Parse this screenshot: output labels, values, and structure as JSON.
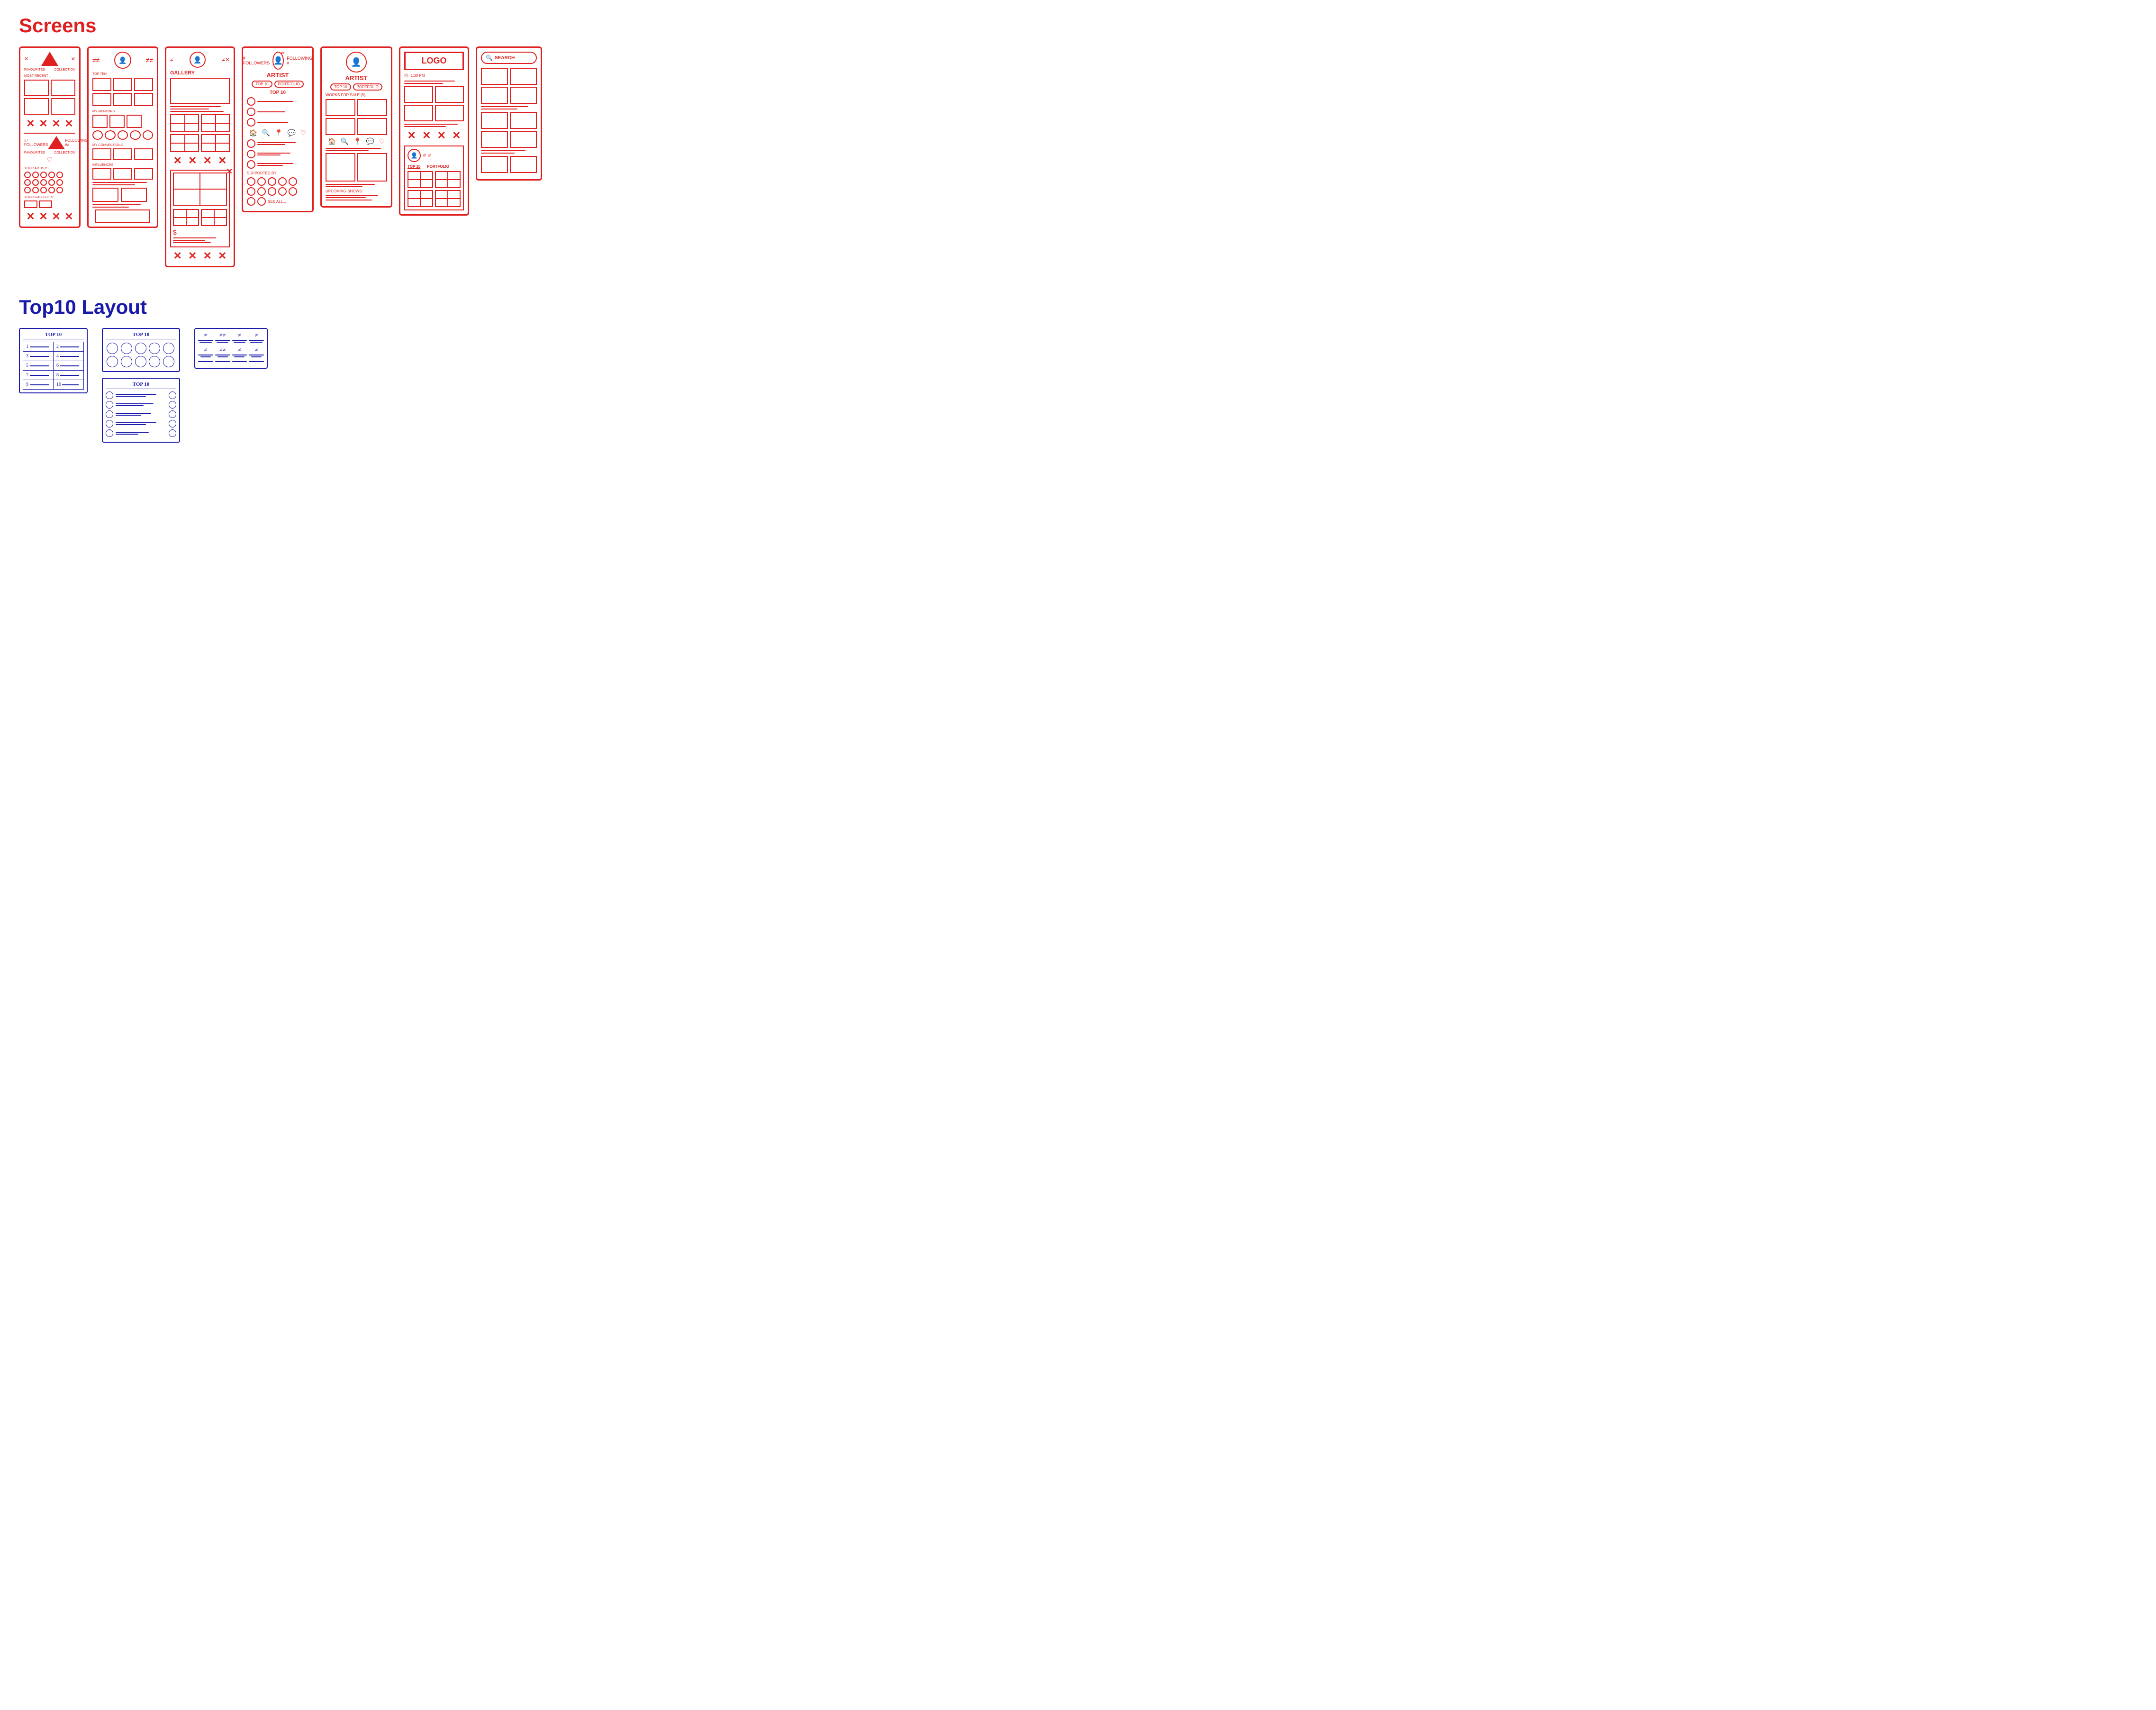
{
  "sections": {
    "screens": {
      "title": "Screens",
      "screens": [
        {
          "id": "home-feed",
          "labels": {
            "favourites": "FAVOURITES",
            "collection": "COLLECTION",
            "most_recent": "MOST RECENT ↓",
            "bottom_icons": [
              "✕",
              "✕",
              "✕",
              "✕"
            ]
          }
        },
        {
          "id": "top-ten",
          "labels": {
            "top_ten": "TOP TEN",
            "my_mentors": "MY MENTORS",
            "my_connections": "MY CONNECTIONS",
            "influences": "INFLUENCES"
          }
        },
        {
          "id": "gallery",
          "labels": {
            "gallery": "GALLERY",
            "bottom_icons": [
              "✕",
              "✕",
              "✕",
              "✕"
            ]
          }
        },
        {
          "id": "artist-loggedin",
          "labels": {
            "followers": "FOLLOWERS",
            "following": "FOLLOWING",
            "artist": "ARTIST",
            "top10": "TOP 10",
            "portfolio": "PORTFOLIO",
            "top10_label": "TOP 10",
            "supported_by": "SUPPORTED BY:",
            "see_all": "SEE ALL..."
          }
        },
        {
          "id": "artist-public",
          "labels": {
            "artist": "ARTIST",
            "top10": "TOP 10",
            "portfolio": "PORTFOLIO",
            "works_for_sale": "WORKS FOR SALE (5)",
            "upcoming_shows": "UPCOMING SHOWS:"
          }
        },
        {
          "id": "logo-status",
          "labels": {
            "logo": "LOGO",
            "time": "1:30 PM",
            "top10": "TOP 10",
            "portfolio": "PORTFOLIO",
            "bottom_icons": [
              "✕",
              "✕",
              "✕",
              "✕"
            ]
          }
        },
        {
          "id": "search",
          "labels": {
            "search": "SEARCH"
          }
        }
      ]
    },
    "top10_layout": {
      "title": "Top10 Layout",
      "cards": [
        {
          "id": "numbered-grid",
          "header": "TOP 10",
          "rows": [
            {
              "num": "1",
              "num2": "2"
            },
            {
              "num": "3",
              "num2": "4"
            },
            {
              "num": "5",
              "num2": "6"
            },
            {
              "num": "7",
              "num2": "8"
            },
            {
              "num": "9",
              "num2": "10"
            }
          ]
        },
        {
          "id": "circles-grid",
          "header": "TOP 10",
          "rows": 2,
          "cols": 5
        },
        {
          "id": "circles-list",
          "header": "TOP 10",
          "items": 5
        },
        {
          "id": "hash-grid",
          "rows": 2,
          "cols": 4
        }
      ]
    }
  }
}
